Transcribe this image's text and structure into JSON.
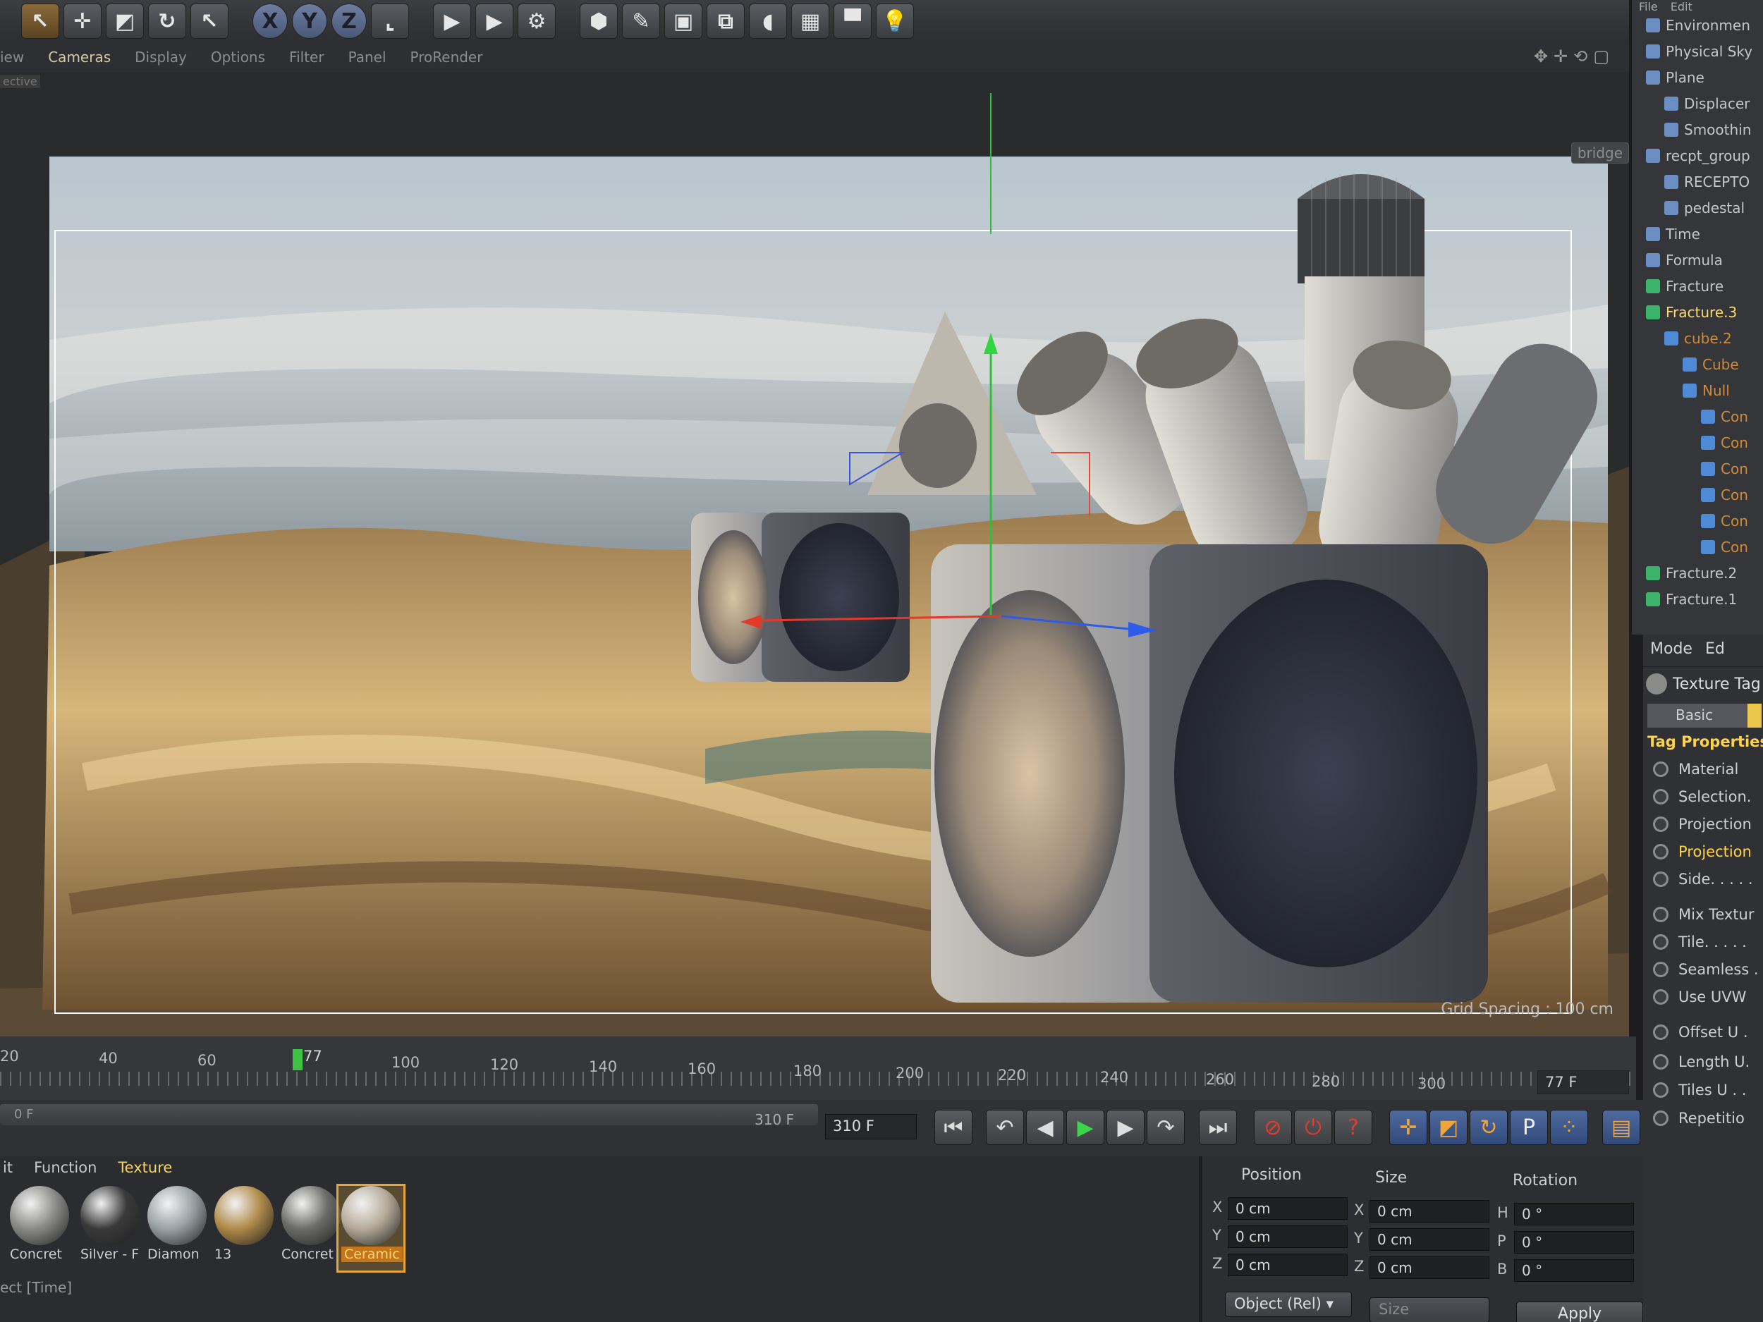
{
  "toolbar": {
    "buttons": [
      {
        "name": "live-selection-icon",
        "glyph": "↖"
      },
      {
        "name": "move-icon",
        "glyph": "✛"
      },
      {
        "name": "scale-icon",
        "glyph": "◩"
      },
      {
        "name": "rotate-icon",
        "glyph": "↻"
      },
      {
        "name": "last-tool-icon",
        "glyph": "↖"
      },
      {
        "name": "x-axis-lock",
        "glyph": "X"
      },
      {
        "name": "y-axis-lock",
        "glyph": "Y"
      },
      {
        "name": "z-axis-lock",
        "glyph": "Z"
      },
      {
        "name": "coordinate-system-icon",
        "glyph": "⌞"
      },
      {
        "name": "render-view-icon",
        "glyph": "▶"
      },
      {
        "name": "render-picture-viewer-icon",
        "glyph": "▶"
      },
      {
        "name": "render-settings-icon",
        "glyph": "⚙"
      },
      {
        "name": "cube-icon",
        "glyph": "⬢"
      },
      {
        "name": "pen-icon",
        "glyph": "✎"
      },
      {
        "name": "subdivision-icon",
        "glyph": "▣"
      },
      {
        "name": "array-icon",
        "glyph": "⧉"
      },
      {
        "name": "deformer-icon",
        "glyph": "◖"
      },
      {
        "name": "floor-icon",
        "glyph": "▦"
      },
      {
        "name": "camera-icon",
        "glyph": "▀"
      },
      {
        "name": "light-icon",
        "glyph": "💡"
      }
    ]
  },
  "view_menu": {
    "items": [
      "iew",
      "Cameras",
      "Display",
      "Options",
      "Filter",
      "Panel",
      "ProRender"
    ],
    "camera_label": "ective",
    "bridge_label": "bridge",
    "grid_spacing": "Grid Spacing : 100 cm"
  },
  "timeline": {
    "ticks": [
      "20",
      "40",
      "60",
      "100",
      "120",
      "140",
      "160",
      "180",
      "200",
      "220",
      "240",
      "260",
      "280",
      "300"
    ],
    "playhead_label": "77",
    "current_frame": "77 F"
  },
  "transport": {
    "range_start": "0 F",
    "range_end": "310 F",
    "max_frame": "310 F"
  },
  "materials": {
    "menu": [
      "it",
      "Function",
      "Texture"
    ],
    "items": [
      {
        "label": "Concret",
        "color": "#8a8a88"
      },
      {
        "label": "Silver - F",
        "color": "#3a3a3a"
      },
      {
        "label": "Diamon",
        "color": "#9aa0a4"
      },
      {
        "label": "13",
        "color": "#b08a4a"
      },
      {
        "label": "Concret",
        "color": "#6b6b69"
      },
      {
        "label": "Ceramic",
        "color": "#b5aa98"
      }
    ],
    "status": "ect [Time]"
  },
  "coordinates": {
    "headers": {
      "position": "Position",
      "size": "Size",
      "rotation": "Rotation"
    },
    "position": {
      "x": "0 cm",
      "y": "0 cm",
      "z": "0 cm"
    },
    "size": {
      "x": "0 cm",
      "y": "0 cm",
      "z": "0 cm"
    },
    "rotation": {
      "h": "0 °",
      "p": "0 °",
      "b": "0 °"
    },
    "mode_dropdown": "Object (Rel)",
    "size_dropdown": "Size",
    "apply": "Apply"
  },
  "object_manager": {
    "menu": [
      "File",
      "Edit"
    ],
    "items": [
      {
        "label": "Environmen",
        "indent": 0,
        "style": ""
      },
      {
        "label": "Physical Sky",
        "indent": 0,
        "style": ""
      },
      {
        "label": "Plane",
        "indent": 0,
        "style": ""
      },
      {
        "label": "Displacer",
        "indent": 1,
        "style": ""
      },
      {
        "label": "Smoothin",
        "indent": 1,
        "style": ""
      },
      {
        "label": "recpt_group",
        "indent": 0,
        "style": ""
      },
      {
        "label": "RECEPTO",
        "indent": 1,
        "style": ""
      },
      {
        "label": "pedestal",
        "indent": 1,
        "style": ""
      },
      {
        "label": "Time",
        "indent": 0,
        "style": ""
      },
      {
        "label": "Formula",
        "indent": 0,
        "style": ""
      },
      {
        "label": "Fracture",
        "indent": 0,
        "style": ""
      },
      {
        "label": "Fracture.3",
        "indent": 0,
        "style": "hi"
      },
      {
        "label": "cube.2",
        "indent": 1,
        "style": "dim"
      },
      {
        "label": "Cube",
        "indent": 2,
        "style": "dim"
      },
      {
        "label": "Null",
        "indent": 2,
        "style": "dim"
      },
      {
        "label": "Con",
        "indent": 3,
        "style": "dim"
      },
      {
        "label": "Con",
        "indent": 3,
        "style": "dim"
      },
      {
        "label": "Con",
        "indent": 3,
        "style": "dim"
      },
      {
        "label": "Con",
        "indent": 3,
        "style": "dim"
      },
      {
        "label": "Con",
        "indent": 3,
        "style": "dim"
      },
      {
        "label": "Con",
        "indent": 3,
        "style": "dim"
      },
      {
        "label": "Fracture.2",
        "indent": 0,
        "style": ""
      },
      {
        "label": "Fracture.1",
        "indent": 0,
        "style": ""
      }
    ]
  },
  "attributes": {
    "menu": [
      "Mode",
      "Ed"
    ],
    "title": "Texture Tag",
    "tab": "Basic",
    "section": "Tag Properties",
    "props": [
      {
        "label": "Material",
        "style": ""
      },
      {
        "label": "Selection.",
        "style": ""
      },
      {
        "label": "Projection",
        "style": ""
      },
      {
        "label": "Projection",
        "style": "hi"
      },
      {
        "label": "Side. . . . .",
        "style": ""
      },
      {
        "label": "Mix Textur",
        "style": ""
      },
      {
        "label": "Tile. . . . .",
        "style": ""
      },
      {
        "label": "Seamless .",
        "style": ""
      },
      {
        "label": "Use UVW",
        "style": ""
      },
      {
        "label": "Offset U .",
        "style": ""
      },
      {
        "label": "Length U.",
        "style": ""
      },
      {
        "label": "Tiles U . .",
        "style": ""
      },
      {
        "label": "Repetitio",
        "style": ""
      }
    ]
  }
}
